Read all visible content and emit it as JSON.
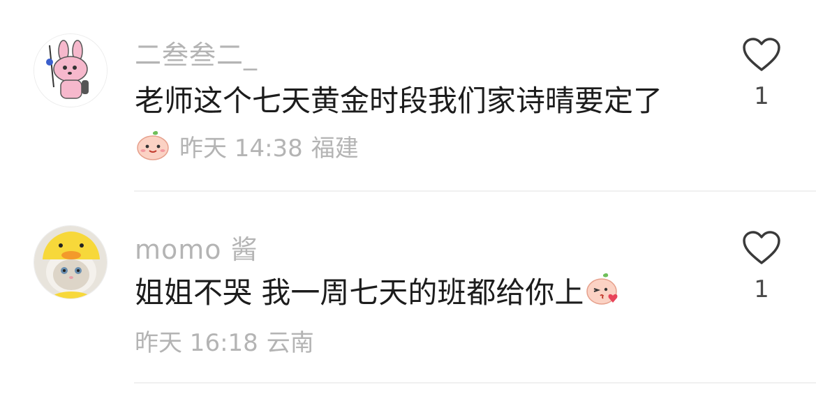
{
  "comments": [
    {
      "username": "二叁叁二_",
      "avatar_icon": "pink-bunny-avatar",
      "content": "老师这个七天黄金时段我们家诗晴要定了",
      "meta_emoji": "peach-smile-emoji",
      "time": "昨天 14:38",
      "location": "福建",
      "like_icon": "heart-outline-icon",
      "like_count": "1"
    },
    {
      "username": "momo 酱",
      "avatar_icon": "cat-duck-hat-avatar",
      "content": "姐姐不哭 我一周七天的班都给你上",
      "content_emoji": "peach-kiss-emoji",
      "time": "昨天 16:18",
      "location": "云南",
      "like_icon": "heart-outline-icon",
      "like_count": "1"
    }
  ],
  "colors": {
    "username": "#b4b4b4",
    "content": "#1c1c1c",
    "meta": "#b4b4b4",
    "divider": "#f0f0f0",
    "like_icon": "#3a3a3a"
  }
}
